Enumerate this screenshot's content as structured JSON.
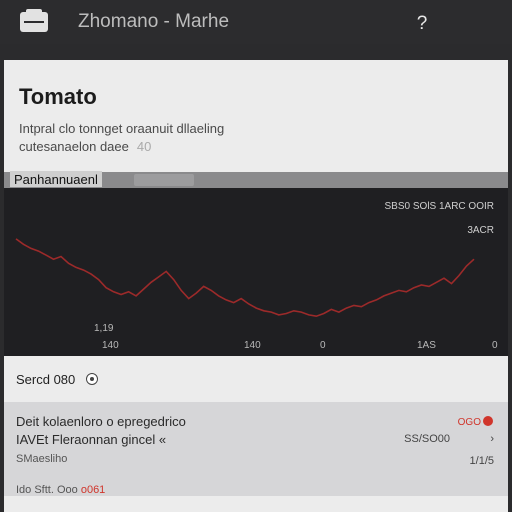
{
  "header": {
    "title": "Zhomano - Marhe",
    "app_icon": "app-icon",
    "help_icon": "help-icon"
  },
  "info": {
    "title": "Tomato",
    "description_line1": "Intpral clo tonnget oraanuit dllaeling",
    "description_line2": "cutesanaelon daee",
    "description_badge": "40"
  },
  "section": {
    "label": "Panhannuaenl"
  },
  "chart": {
    "legend": "SBS0 SOlS 1ARC OOIR",
    "sublabel": "3ACR",
    "tick_y": "1,19",
    "tick_x": [
      "140",
      "140",
      "0",
      "1AS",
      "0"
    ]
  },
  "chart_data": {
    "type": "line",
    "series": [
      {
        "color": "#9c2a2a",
        "values": [
          62,
          58,
          55,
          53,
          50,
          47,
          49,
          44,
          41,
          39,
          36,
          32,
          26,
          23,
          21,
          23,
          20,
          25,
          30,
          34,
          38,
          32,
          24,
          18,
          22,
          27,
          24,
          20,
          17,
          15,
          18,
          14,
          11,
          9,
          8,
          6,
          7,
          9,
          8,
          6,
          5,
          7,
          10,
          8,
          11,
          13,
          12,
          15,
          17,
          20,
          22,
          24,
          23,
          26,
          28,
          27,
          30,
          33,
          29,
          35,
          42,
          47
        ]
      }
    ],
    "grid": false
  },
  "search": {
    "label": "Sercd 080"
  },
  "detail": {
    "title": "Deit kolaenloro o epregedrico",
    "subtitle": "IAVEt Fleraonnan gincel «",
    "meta": "SMaesliho",
    "footer_prefix": "Ido Sftt. Ooo",
    "footer_value": "o061",
    "status": "OGO",
    "value": "SS/SO00",
    "date": "1/1/5"
  },
  "colors": {
    "background": "#2b2b2d",
    "panel": "#ececec",
    "chart_bg": "#1f1f22",
    "line": "#9c2a2a",
    "accent": "#d0352b"
  }
}
